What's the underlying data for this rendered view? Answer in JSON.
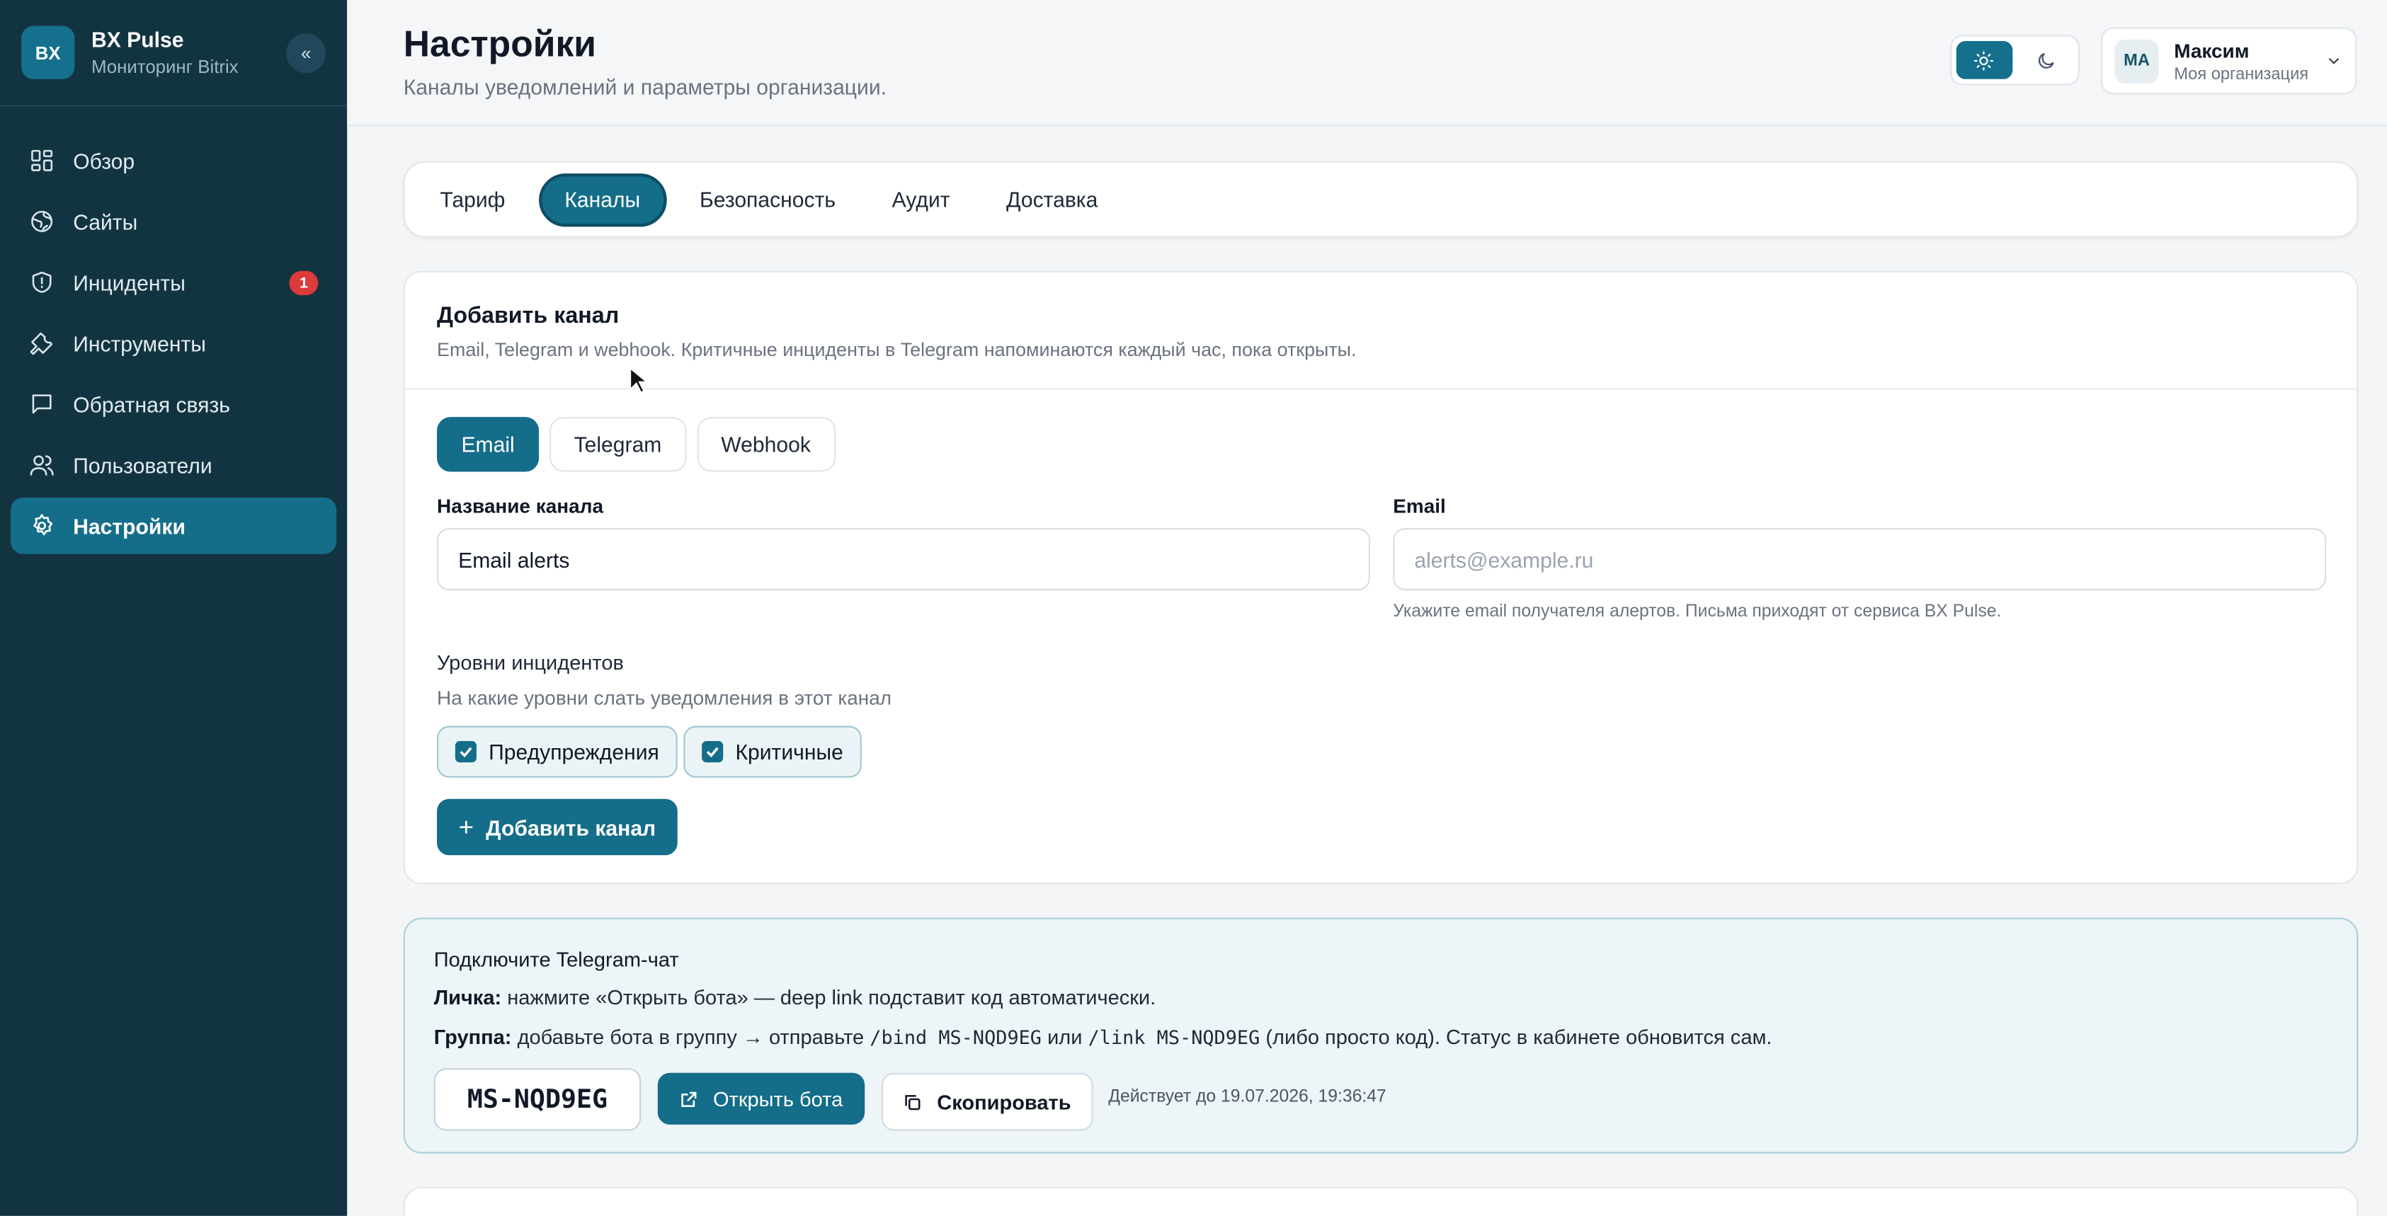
{
  "brand": {
    "logo": "BX",
    "name": "BX Pulse",
    "subtitle": "Мониторинг Bitrix",
    "collapse_icon": "«"
  },
  "sidebar": {
    "items": [
      {
        "label": "Обзор",
        "icon": "grid-icon"
      },
      {
        "label": "Сайты",
        "icon": "globe-icon"
      },
      {
        "label": "Инциденты",
        "icon": "shield-icon",
        "badge": "1"
      },
      {
        "label": "Инструменты",
        "icon": "wrench-icon"
      },
      {
        "label": "Обратная связь",
        "icon": "chat-icon"
      },
      {
        "label": "Пользователи",
        "icon": "users-icon"
      },
      {
        "label": "Настройки",
        "icon": "gear-icon",
        "active": true
      }
    ]
  },
  "header": {
    "title": "Настройки",
    "subtitle": "Каналы уведомлений и параметры организации.",
    "theme": {
      "active": "light"
    },
    "user": {
      "initials": "МА",
      "name": "Максим",
      "org": "Моя организация"
    }
  },
  "tabs": [
    {
      "label": "Тариф"
    },
    {
      "label": "Каналы",
      "active": true
    },
    {
      "label": "Безопасность"
    },
    {
      "label": "Аудит"
    },
    {
      "label": "Доставка"
    }
  ],
  "add_channel": {
    "title": "Добавить канал",
    "description": "Email, Telegram и webhook. Критичные инциденты в Telegram напоминаются каждый час, пока открыты.",
    "types": [
      {
        "label": "Email",
        "active": true
      },
      {
        "label": "Telegram"
      },
      {
        "label": "Webhook"
      }
    ],
    "name_label": "Название канала",
    "name_value": "Email alerts",
    "email_label": "Email",
    "email_placeholder": "alerts@example.ru",
    "email_hint": "Укажите email получателя алертов. Письма приходят от сервиса BX Pulse.",
    "levels_title": "Уровни инцидентов",
    "levels_sub": "На какие уровни слать уведомления в этот канал",
    "levels": [
      {
        "label": "Предупреждения",
        "checked": true
      },
      {
        "label": "Критичные",
        "checked": true
      }
    ],
    "add_button": "Добавить канал"
  },
  "telegram": {
    "title": "Подключите Telegram-чат",
    "personal_label": "Личка:",
    "personal_text": "нажмите «Открыть бота» — deep link подставит код автоматически.",
    "group_label": "Группа:",
    "group_text_1": "добавьте бота в группу → отправьте",
    "group_cmd_1": "/bind MS-NQD9EG",
    "group_text_2": "или",
    "group_cmd_2": "/link MS-NQD9EG",
    "group_text_3": "(либо просто код). Статус в кабинете обновится сам.",
    "code": "MS-NQD9EG",
    "open_button": "Открыть бота",
    "copy_button": "Скопировать",
    "valid_until": "Действует до 19.07.2026, 19:36:47"
  },
  "colors": {
    "sidebar_bg": "#123440",
    "accent": "#146d89",
    "badge": "#dc3b3b"
  }
}
